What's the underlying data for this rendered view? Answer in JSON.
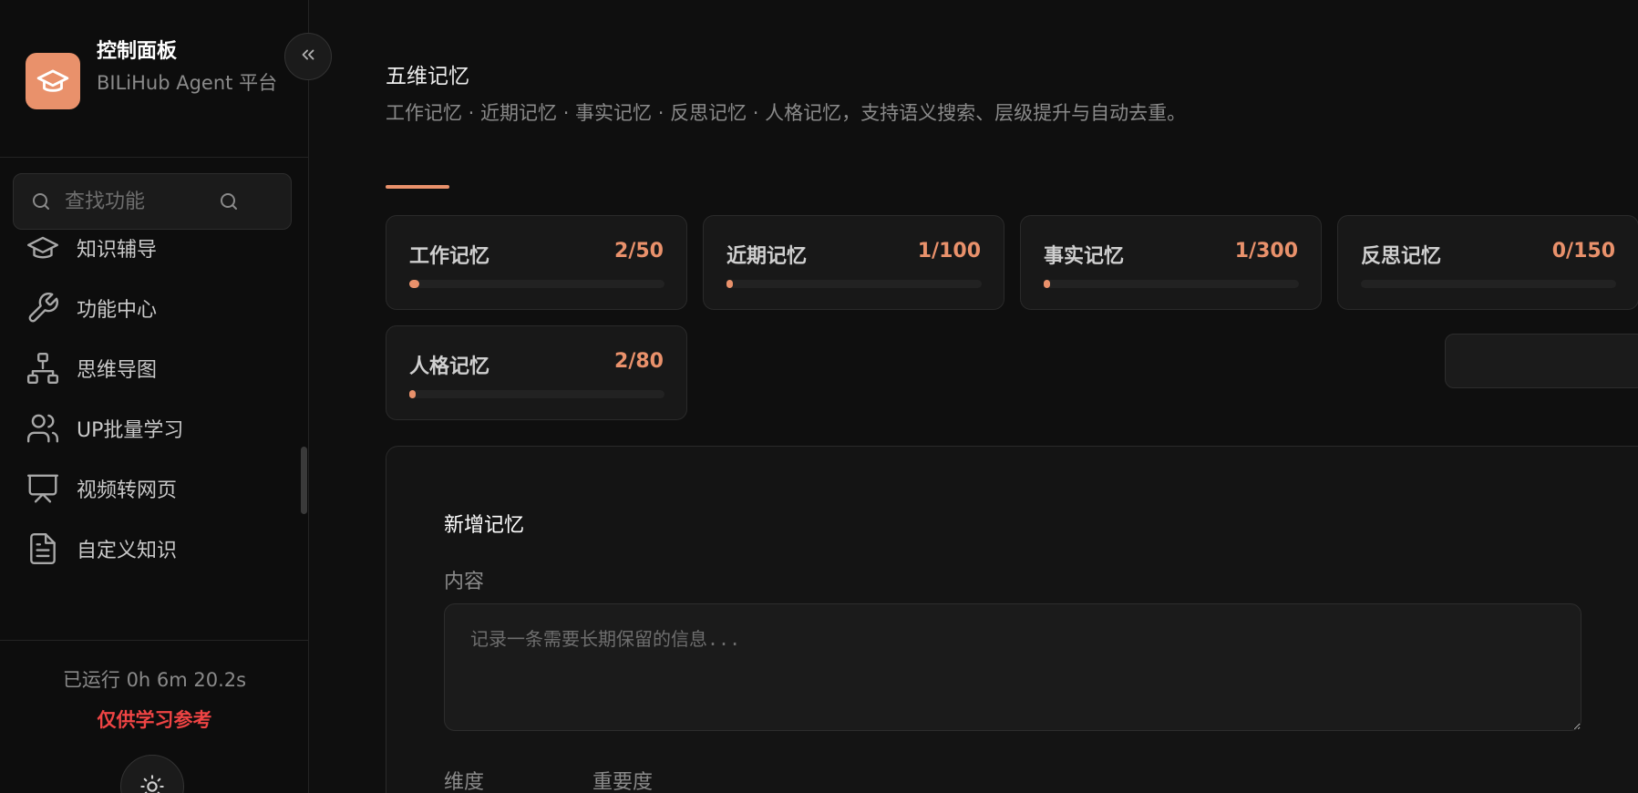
{
  "sidebar": {
    "brand_title": "控制面板",
    "brand_subtitle": "BILiHub Agent 平台",
    "search_placeholder": "查找功能",
    "items": [
      {
        "label": "知识辅导",
        "icon": "graduation-cap-icon"
      },
      {
        "label": "功能中心",
        "icon": "wrench-icon"
      },
      {
        "label": "思维导图",
        "icon": "sitemap-icon"
      },
      {
        "label": "UP批量学习",
        "icon": "users-icon"
      },
      {
        "label": "视频转网页",
        "icon": "presentation-icon"
      },
      {
        "label": "自定义知识",
        "icon": "file-text-icon"
      }
    ],
    "runtime": "已运行 0h 6m 20.2s",
    "disclaimer": "仅供学习参考"
  },
  "main": {
    "title": "五维记忆",
    "description": "工作记忆 · 近期记忆 · 事实记忆 · 反思记忆 · 人格记忆，支持语义搜索、层级提升与自动去重。",
    "stats": [
      {
        "name": "工作记忆",
        "count": "2/50",
        "fill": 0.04
      },
      {
        "name": "近期记忆",
        "count": "1/100",
        "fill": 0.01
      },
      {
        "name": "事实记忆",
        "count": "1/300",
        "fill": 0.003
      },
      {
        "name": "反思记忆",
        "count": "0/150",
        "fill": 0
      },
      {
        "name": "人格记忆",
        "count": "2/80",
        "fill": 0.025
      }
    ],
    "form": {
      "title": "新增记忆",
      "content_label": "内容",
      "content_placeholder": "记录一条需要长期保留的信息...",
      "dimension_label": "维度",
      "importance_label": "重要度"
    }
  },
  "colors": {
    "accent": "#e9916b",
    "danger": "#ef4444",
    "background": "#0f0f0f"
  }
}
